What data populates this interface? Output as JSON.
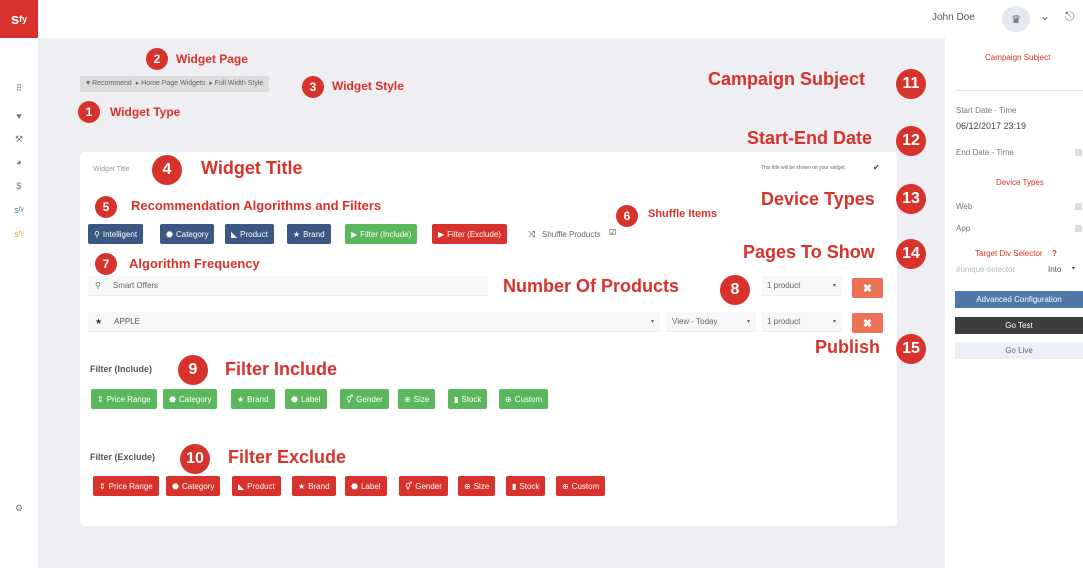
{
  "topbar": {
    "logo": "s",
    "logo_sup": "fy",
    "user_name": "John Doe",
    "crown_glyph": "♛",
    "chevron_glyph": "⌄",
    "logout_glyph": "⎋"
  },
  "nav": {
    "icons": [
      "grid-icon",
      "heart-icon",
      "tools-icon",
      "pie-icon",
      "dollar-icon",
      "sfy-icon",
      "sfy-alt-icon",
      "gear-icon"
    ],
    "glyphs": {
      "grid": "⠿",
      "heart": "♥",
      "tools": "⚒",
      "pie": "◕",
      "dollar": "$",
      "sfy": "sᶠʸ",
      "sfy2": "sᶠʸ",
      "gear": "⚙"
    }
  },
  "breadcrumb": {
    "items": [
      "♥ Recommend",
      "▸ Home Page Widgets",
      "▸ Full Width Style"
    ]
  },
  "annotations": {
    "n1": "1",
    "l1": "Widget Type",
    "n2": "2",
    "l2": "Widget Page",
    "n3": "3",
    "l3": "Widget Style",
    "n4": "4",
    "l4": "Widget Title",
    "n5": "5",
    "l5": "Recommendation Algorithms and Filters",
    "n6": "6",
    "l6": "Shuffle Items",
    "n7": "7",
    "l7": "Algorithm Frequency",
    "n8": "8",
    "l8": "Number Of Products",
    "n9": "9",
    "l9": "Filter Include",
    "n10": "10",
    "l10": "Filter Exclude",
    "n11": "11",
    "l11": "Campaign Subject",
    "n12": "12",
    "l12": "Start-End Date",
    "n13": "13",
    "l13": "Device Types",
    "n14": "14",
    "l14": "Pages To Show",
    "n15": "15",
    "l15": "Publish"
  },
  "widget": {
    "title_placeholder": "Widget Title",
    "title_hint": "This title will be shown on your widget",
    "check_glyph": "✔"
  },
  "algo_buttons": [
    {
      "icon": "⚲",
      "label": "Intelligent"
    },
    {
      "icon": "⬣",
      "label": "Category"
    },
    {
      "icon": "◣",
      "label": "Product"
    },
    {
      "icon": "★",
      "label": "Brand"
    },
    {
      "icon": "▶",
      "label": "Filter (Include)"
    },
    {
      "icon": "▶",
      "label": "Filter (Exclude)"
    }
  ],
  "shuffle": {
    "icon": "⤨",
    "label": "Shuffle Products",
    "check": "☑"
  },
  "rows": [
    {
      "icon": "⚲",
      "label": "Smart Offers",
      "count": "1 product",
      "arrow": "▾",
      "x": "✖"
    },
    {
      "icon": "★",
      "label": "APPLE",
      "period": "View - Today",
      "count": "1 product",
      "arrow": "▾",
      "x": "✖"
    }
  ],
  "filter_include": {
    "title": "Filter (Include)",
    "buttons": [
      {
        "icon": "⇕",
        "label": "Price Range"
      },
      {
        "icon": "⬣",
        "label": "Category"
      },
      {
        "icon": "★",
        "label": "Brand"
      },
      {
        "icon": "⬣",
        "label": "Label"
      },
      {
        "icon": "⚥",
        "label": "Gender"
      },
      {
        "icon": "⊕",
        "label": "Size"
      },
      {
        "icon": "▮",
        "label": "Stock"
      },
      {
        "icon": "⊕",
        "label": "Custom"
      }
    ]
  },
  "filter_exclude": {
    "title": "Filter (Exclude)",
    "buttons": [
      {
        "icon": "⇕",
        "label": "Price Range"
      },
      {
        "icon": "⬣",
        "label": "Category"
      },
      {
        "icon": "◣",
        "label": "Product"
      },
      {
        "icon": "★",
        "label": "Brand"
      },
      {
        "icon": "⬣",
        "label": "Label"
      },
      {
        "icon": "⚥",
        "label": "Gender"
      },
      {
        "icon": "⊕",
        "label": "Size"
      },
      {
        "icon": "▮",
        "label": "Stock"
      },
      {
        "icon": "⊕",
        "label": "Custom"
      }
    ]
  },
  "right_panel": {
    "campaign_subject": "Campaign Subject",
    "start_label": "Start Date - Time",
    "start_value": "06/12/2017 23:19",
    "end_label": "End Date - Time",
    "device_types": "Device Types",
    "web": "Web",
    "app": "App",
    "target_div": "Target Div Selector",
    "help_glyph": "?",
    "selector_placeholder": "#unique-selector",
    "into": "Into",
    "into_arrow": "▾",
    "advanced": "Advanced Configuration",
    "go_test": "Go Test",
    "go_live": "Go Live"
  },
  "colors": {
    "accent": "#d7322c",
    "blue": "#3b5783",
    "green": "#5bb75b",
    "orange": "#ed7157"
  }
}
